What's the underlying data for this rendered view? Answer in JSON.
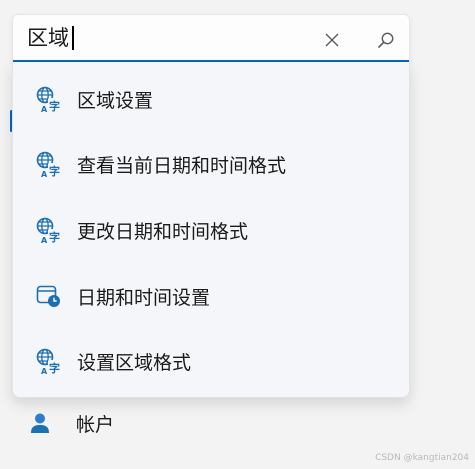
{
  "search": {
    "value": "区域"
  },
  "results": [
    {
      "label": "区域设置",
      "icon": "globe-language-icon"
    },
    {
      "label": "查看当前日期和时间格式",
      "icon": "globe-language-icon"
    },
    {
      "label": "更改日期和时间格式",
      "icon": "globe-language-icon"
    },
    {
      "label": "日期和时间设置",
      "icon": "calendar-clock-icon"
    },
    {
      "label": "设置区域格式",
      "icon": "globe-language-icon"
    }
  ],
  "background_nav": {
    "account_label": "帐户"
  },
  "watermark": "CSDN @kangtian204",
  "colors": {
    "accent": "#0067c0",
    "icon_blue": "#1a6fb5"
  }
}
